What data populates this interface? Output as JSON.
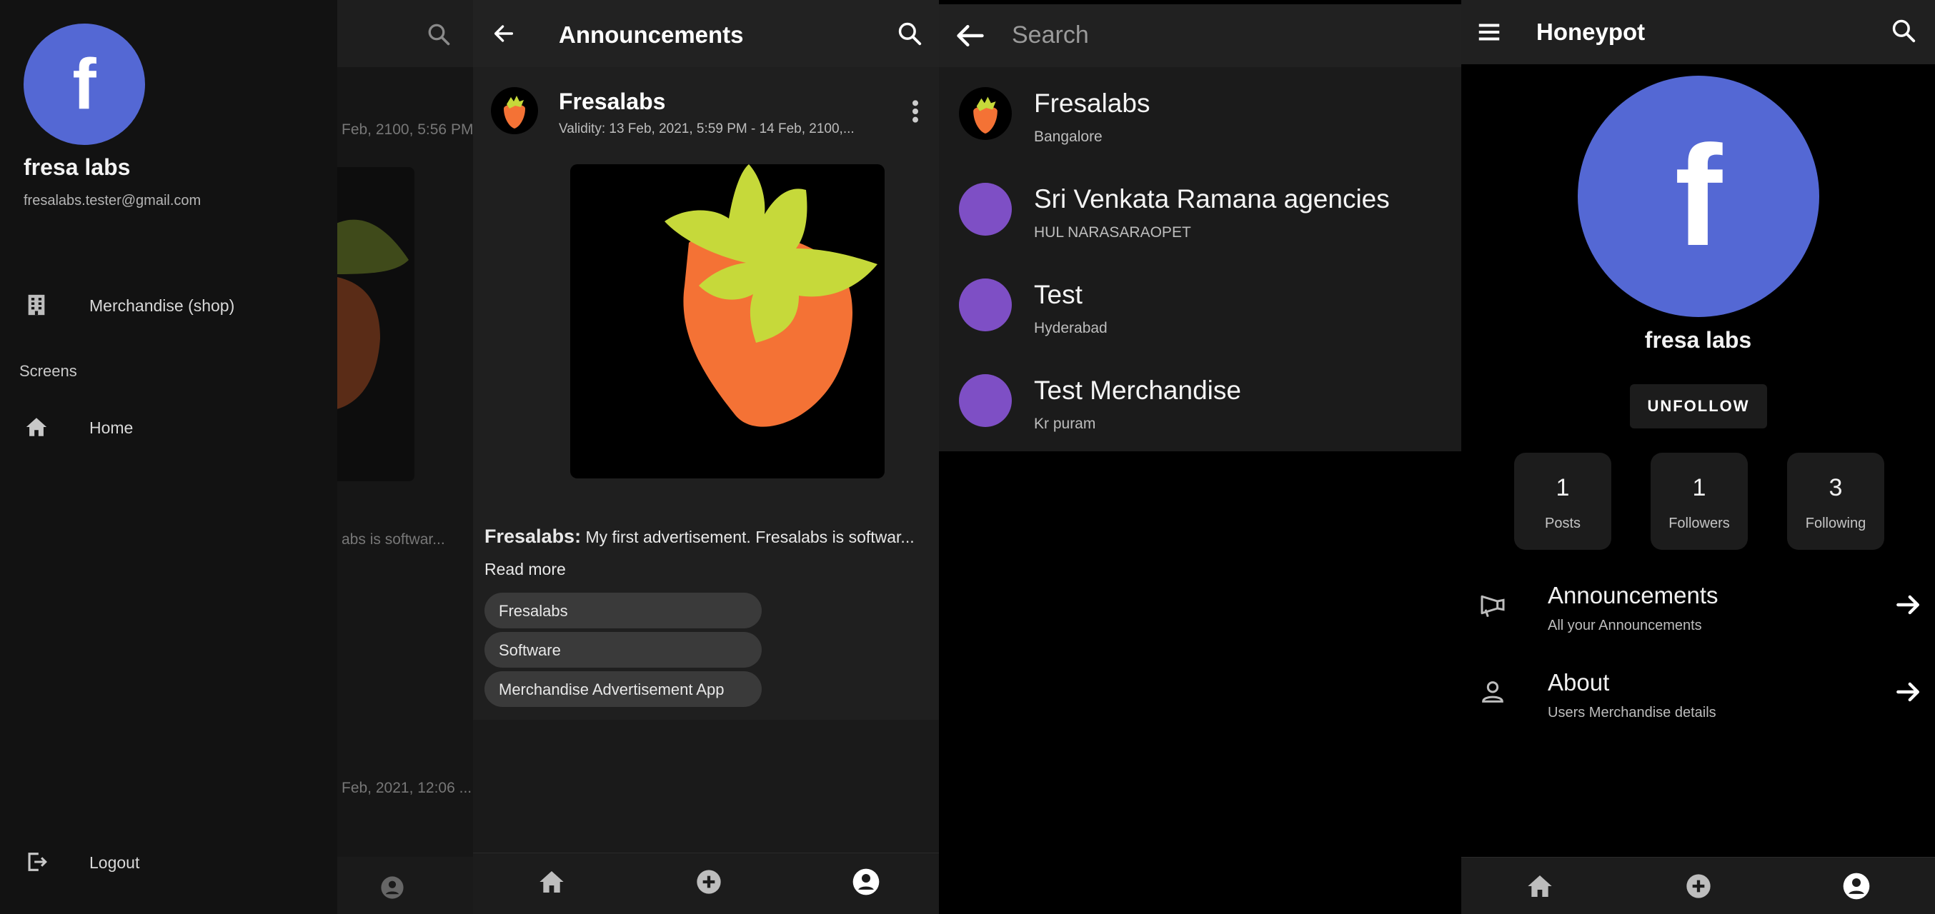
{
  "drawer": {
    "avatar_letter": "f",
    "name": "fresa labs",
    "email": "fresalabs.tester@gmail.com",
    "items": [
      {
        "label": "Merchandise (shop)",
        "icon": "building-icon"
      },
      {
        "label": "Home",
        "icon": "home-icon"
      },
      {
        "label": "Logout",
        "icon": "logout-icon"
      }
    ],
    "section_label": "Screens",
    "behind": {
      "line1": "Feb, 2100, 5:56 PM",
      "line2": "abs is softwar...",
      "line3": "Feb, 2021, 12:06 ..."
    }
  },
  "announcements": {
    "title": "Announcements",
    "post": {
      "author": "Fresalabs",
      "validity": "Validity: 13 Feb, 2021, 5:59 PM - 14 Feb, 2100,...",
      "body_author": "Fresalabs:",
      "body_text": " My first advertisement. Fresalabs is softwar...",
      "read_more": "Read more",
      "tags": [
        "Fresalabs",
        "Software",
        "Merchandise Advertisement App"
      ]
    }
  },
  "search": {
    "placeholder": "Search",
    "results": [
      {
        "name": "Fresalabs",
        "location": "Bangalore"
      },
      {
        "name": "Sri Venkata Ramana agencies",
        "location": "HUL NARASARAOPET"
      },
      {
        "name": "Test",
        "location": "Hyderabad"
      },
      {
        "name": "Test Merchandise",
        "location": "Kr puram"
      }
    ]
  },
  "profile": {
    "app_title": "Honeypot",
    "avatar_letter": "f",
    "name": "fresa labs",
    "unfollow_label": "UNFOLLOW",
    "stats": [
      {
        "value": "1",
        "label": "Posts"
      },
      {
        "value": "1",
        "label": "Followers"
      },
      {
        "value": "3",
        "label": "Following"
      }
    ],
    "rows": [
      {
        "title": "Announcements",
        "subtitle": "All your Announcements",
        "icon": "megaphone-icon"
      },
      {
        "title": "About",
        "subtitle": "Users Merchandise details",
        "icon": "person-icon"
      }
    ]
  },
  "colors": {
    "avatar_blue": "#5468d4",
    "result_purple": "#7e4fc5",
    "strawberry_orange": "#f47235",
    "strawberry_leaf": "#c6d93a"
  }
}
